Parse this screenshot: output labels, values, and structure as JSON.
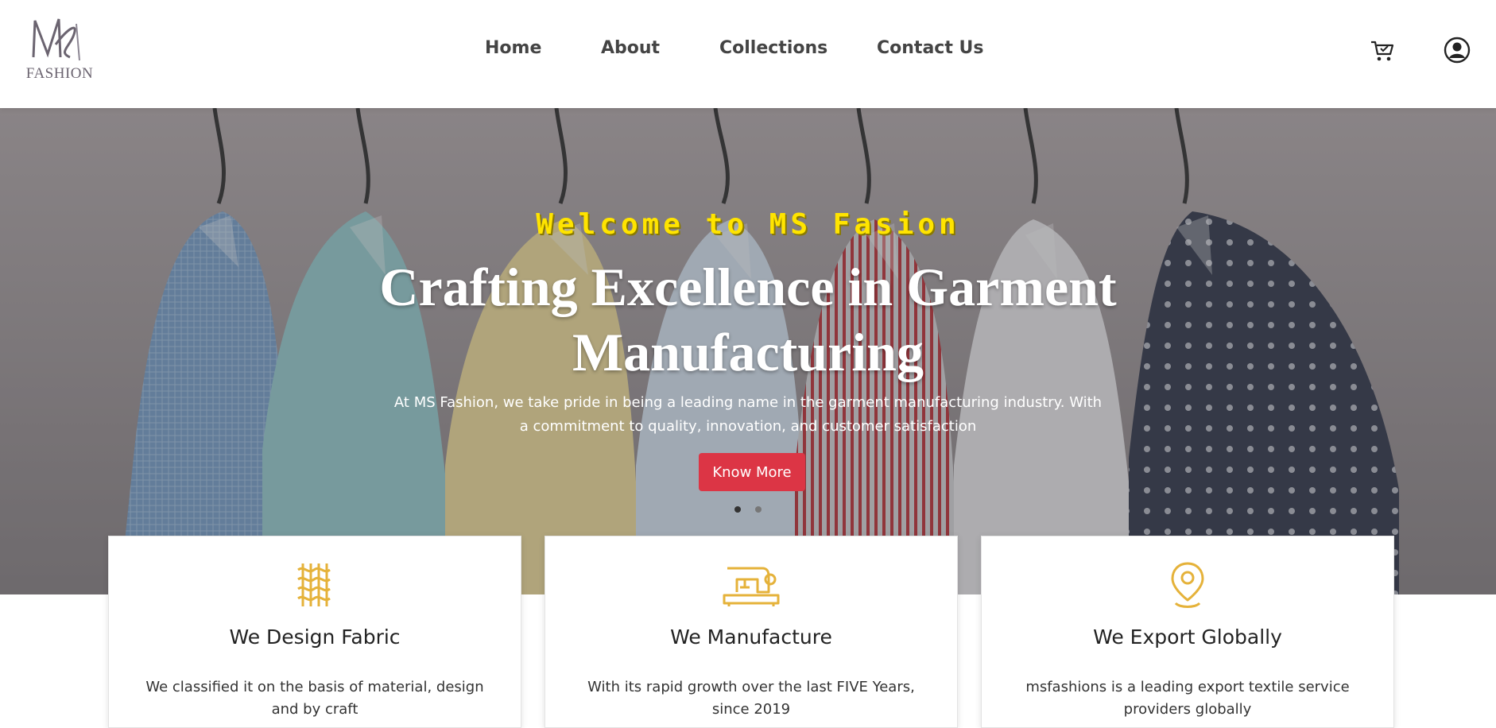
{
  "brand": {
    "logo_text": "FASHION"
  },
  "nav": {
    "items": [
      {
        "label": "Home"
      },
      {
        "label": "About"
      },
      {
        "label": "Collections"
      },
      {
        "label": "Contact Us"
      }
    ]
  },
  "header_icons": {
    "cart": "cart-icon",
    "account": "user-circle-icon"
  },
  "hero": {
    "welcome": "Welcome to MS Fasion",
    "headline": "Crafting Excellence in Garment Manufacturing",
    "subtext": "At MS Fashion, we take pride in being a leading name in the garment manufacturing industry. With a commitment to quality, innovation, and customer satisfaction",
    "cta_label": "Know More",
    "slides_total": 2,
    "active_slide": 1
  },
  "features": [
    {
      "icon": "weave-fabric-icon",
      "title": "We Design Fabric",
      "text": "We classified it on the basis of material, design and by craft"
    },
    {
      "icon": "sewing-machine-icon",
      "title": "We Manufacture",
      "text": "With its rapid growth over the last FIVE Years, since 2019"
    },
    {
      "icon": "location-pin-icon",
      "title": "We Export Globally",
      "text": "msfashions is a leading export textile service providers globally"
    }
  ],
  "colors": {
    "accent_red": "#dc3545",
    "welcome_yellow": "#ffe400",
    "icon_gold": "#e5b23a",
    "nav_text": "#444444"
  }
}
